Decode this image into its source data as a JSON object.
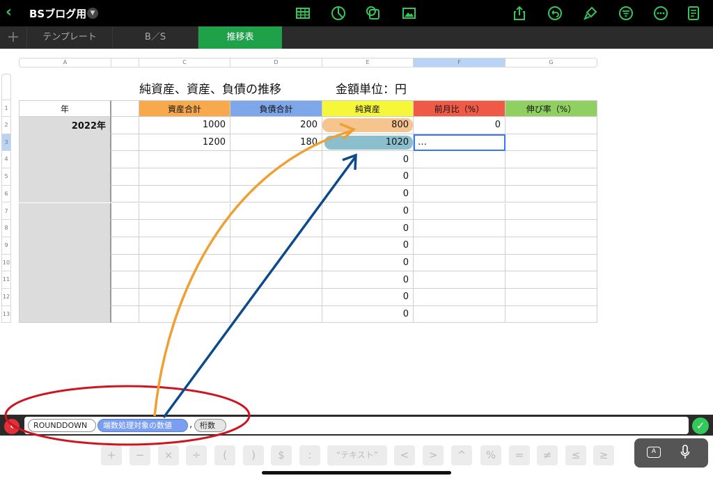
{
  "app": {
    "doc_title": "BSブログ用"
  },
  "toolbar": {
    "icons": [
      "table-icon",
      "chart-icon",
      "shape-icon",
      "media-icon",
      "share-icon",
      "undo-icon",
      "format-brush-icon",
      "organize-icon",
      "more-icon",
      "document-icon"
    ]
  },
  "tabs": [
    {
      "label": "テンプレート"
    },
    {
      "label": "B／S"
    },
    {
      "label": "推移表"
    }
  ],
  "sheet": {
    "title": "純資産、資産、負債の推移",
    "unit": "金額単位：円",
    "column_letters": [
      "A",
      "",
      "C",
      "D",
      "E",
      "F",
      "G"
    ],
    "row_numbers": [
      "1",
      "2",
      "3",
      "4",
      "5",
      "6",
      "7",
      "8",
      "9",
      "10",
      "11",
      "12",
      "13"
    ],
    "headers": [
      "年",
      "",
      "資産合計",
      "負債合計",
      "純資産",
      "前月比（%）",
      "伸び率（%）"
    ],
    "header_colors": [
      "#ffffff",
      "#ffffff",
      "#f7a94b",
      "#7ea7ea",
      "#f7f73a",
      "#ee5a46",
      "#8fd061"
    ],
    "year": "2022年",
    "rows": [
      {
        "assets": "1000",
        "liabilities": "200",
        "net": "800",
        "mom": "0",
        "growth": ""
      },
      {
        "assets": "1200",
        "liabilities": "180",
        "net": "1020",
        "mom": "…",
        "growth": ""
      },
      {
        "assets": "",
        "liabilities": "",
        "net": "0",
        "mom": "",
        "growth": ""
      },
      {
        "assets": "",
        "liabilities": "",
        "net": "0",
        "mom": "",
        "growth": ""
      },
      {
        "assets": "",
        "liabilities": "",
        "net": "0",
        "mom": "",
        "growth": ""
      },
      {
        "assets": "",
        "liabilities": "",
        "net": "0",
        "mom": "",
        "growth": ""
      },
      {
        "assets": "",
        "liabilities": "",
        "net": "0",
        "mom": "",
        "growth": ""
      },
      {
        "assets": "",
        "liabilities": "",
        "net": "0",
        "mom": "",
        "growth": ""
      },
      {
        "assets": "",
        "liabilities": "",
        "net": "0",
        "mom": "",
        "growth": ""
      },
      {
        "assets": "",
        "liabilities": "",
        "net": "0",
        "mom": "",
        "growth": ""
      },
      {
        "assets": "",
        "liabilities": "",
        "net": "0",
        "mom": "",
        "growth": ""
      },
      {
        "assets": "",
        "liabilities": "",
        "net": "0",
        "mom": "",
        "growth": ""
      }
    ]
  },
  "formula": {
    "func": "ROUNDDOWN",
    "arg1": "端数処理対象の数値",
    "sep": ",",
    "arg2": "桁数"
  },
  "keys": [
    "+",
    "−",
    "×",
    "÷",
    "(",
    ")",
    "$",
    ":",
    "“テキスト”",
    "<",
    ">",
    "^",
    "%",
    "=",
    "≠",
    "≤",
    "≥"
  ],
  "colors": {
    "accent": "#34c759",
    "tab_active": "#1fa14a",
    "annotation_red": "#d0141e",
    "arrow_orange": "#f0a030",
    "arrow_blue": "#0d4a8c"
  }
}
